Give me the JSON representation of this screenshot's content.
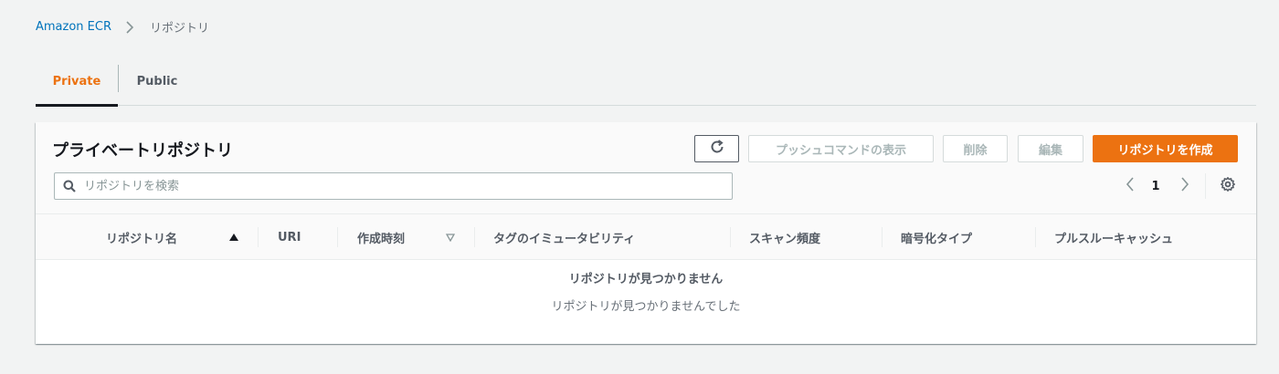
{
  "breadcrumb": {
    "root": "Amazon ECR",
    "current": "リポジトリ"
  },
  "tabs": [
    {
      "label": "Private",
      "active": true
    },
    {
      "label": "Public",
      "active": false
    }
  ],
  "panel": {
    "title": "プライベートリポジトリ",
    "buttons": {
      "push": "プッシュコマンドの表示",
      "delete": "削除",
      "edit": "編集",
      "create": "リポジトリを作成"
    },
    "search": {
      "placeholder": "リポジトリを検索",
      "value": ""
    },
    "pagination": {
      "current_page": "1"
    },
    "columns": [
      "リポジトリ名",
      "URI",
      "作成時刻",
      "タグのイミュータビリティ",
      "スキャン頻度",
      "暗号化タイプ",
      "プルスルーキャッシュ"
    ],
    "empty": {
      "title": "リポジトリが見つかりません",
      "message": "リポジトリが見つかりませんでした"
    }
  },
  "icons": {
    "refresh": "refresh-icon",
    "search": "search-icon",
    "prev": "chevron-left-icon",
    "next": "chevron-right-icon",
    "settings": "gear-icon",
    "sort_asc": "sort-ascending-icon",
    "sort_desc": "sort-descending-icon"
  },
  "colors": {
    "accent": "#ec7211",
    "link": "#0073bb",
    "background": "#f2f3f3"
  }
}
